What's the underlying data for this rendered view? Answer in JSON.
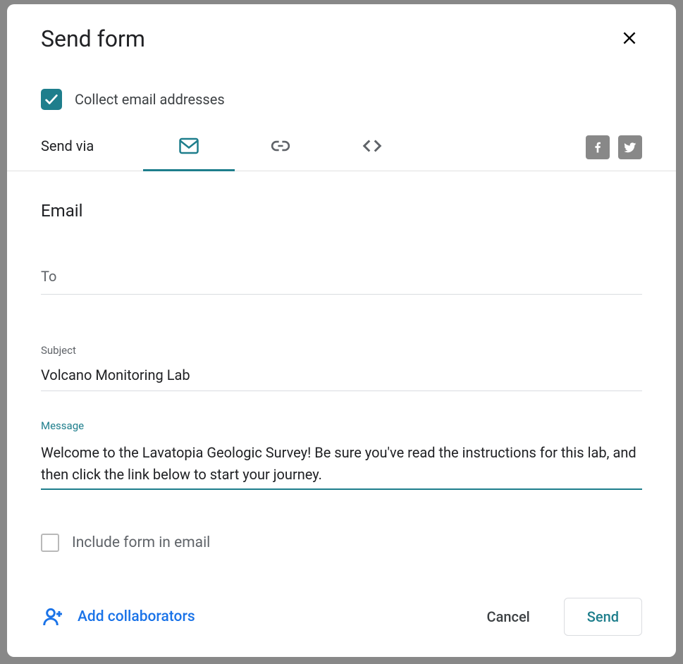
{
  "dialog": {
    "title": "Send form"
  },
  "collect": {
    "label": "Collect email addresses",
    "checked": true
  },
  "tabs": {
    "send_via_label": "Send via"
  },
  "email_section": {
    "heading": "Email",
    "to_placeholder": "To",
    "to_value": "",
    "subject_label": "Subject",
    "subject_value": "Volcano Monitoring Lab",
    "message_label": "Message",
    "message_value": "Welcome to the Lavatopia Geologic Survey! Be sure you've read the instructions for this lab, and then click the link below to start your journey."
  },
  "include": {
    "label": "Include form in email",
    "checked": false
  },
  "footer": {
    "add_collab": "Add collaborators",
    "cancel": "Cancel",
    "send": "Send"
  }
}
